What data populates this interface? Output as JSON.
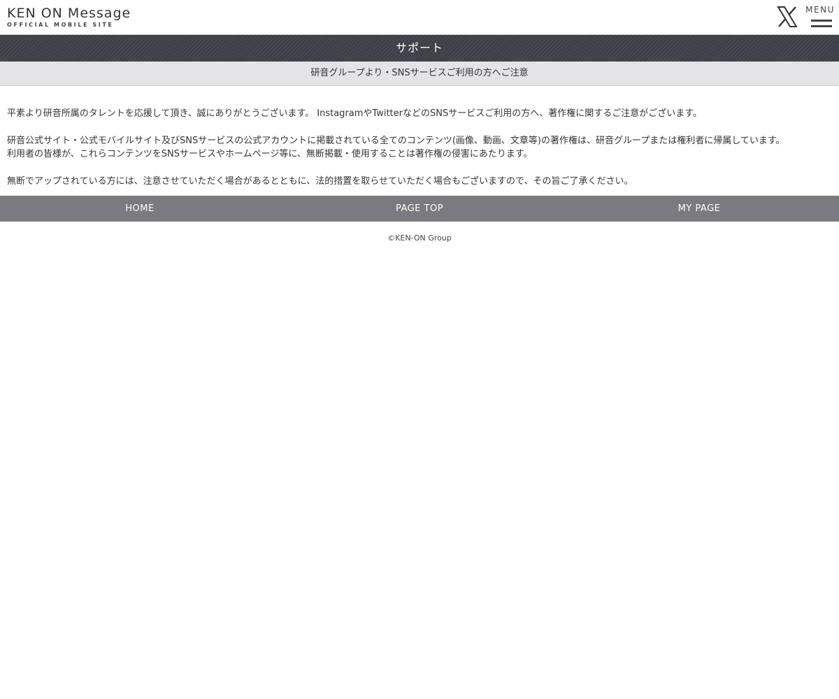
{
  "header": {
    "logo_main": "KEN ON Message",
    "logo_sub": "OFFICIAL MOBILE SITE",
    "x_icon": "x-logo-icon",
    "menu_label": "MENU",
    "menu_icon": "hamburger-menu-icon"
  },
  "page": {
    "title": "サポート",
    "subtitle": "研音グループより・SNSサービスご利用の方へご注意"
  },
  "content": {
    "paragraph_1": "平素より研音所属のタレントを応援して頂き、誠にありがとうございます。 InstagramやTwitterなどのSNSサービスご利用の方へ、著作権に関するご注意がございます。",
    "paragraph_2_line_1": "研音公式サイト・公式モバイルサイト及びSNSサービスの公式アカウントに掲載されている全てのコンテンツ(画像、動画、文章等)の著作権は、研音グループまたは権利者に帰属しています。",
    "paragraph_2_line_2": "利用者の皆様が、これらコンテンツをSNSサービスやホームページ等に、無断掲載・使用することは著作権の侵害にあたります。",
    "paragraph_3": "無断でアップされている方には、注意させていただく場合があるとともに、法的措置を取らせていただく場合もございますので、その旨ご了承ください。"
  },
  "footer": {
    "nav": [
      "HOME",
      "PAGE TOP",
      "MY PAGE"
    ],
    "copyright": "©KEN-ON Group"
  },
  "colors": {
    "title_bar": "#3f3f47",
    "subtitle_bar": "#e4e4e8",
    "footer_nav": "#7a7a80",
    "text": "#333333"
  }
}
